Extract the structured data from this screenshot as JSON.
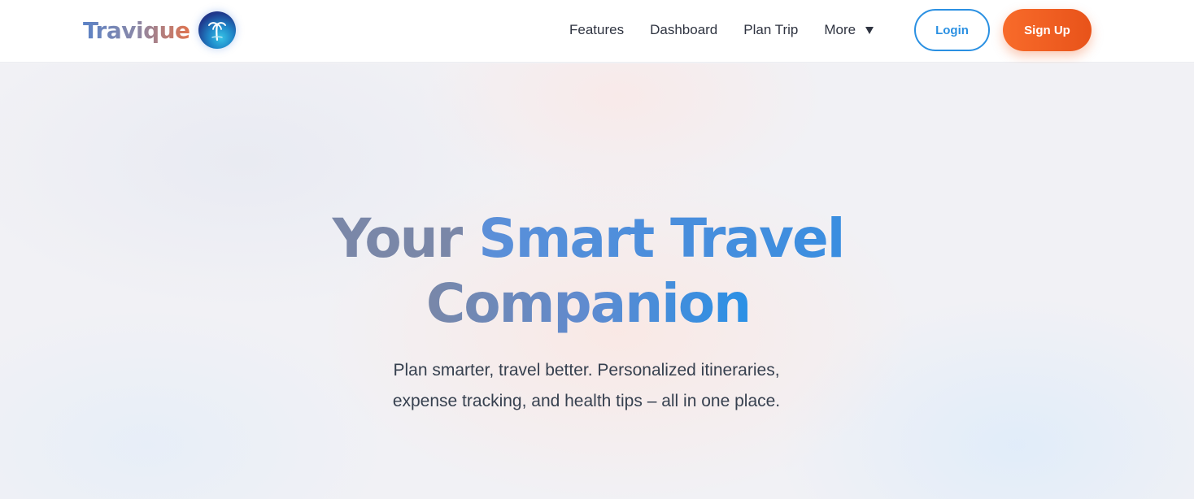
{
  "brand": {
    "name": "Travique",
    "logo_icon": "palm-tree-globe-icon"
  },
  "nav": {
    "links": [
      "Features",
      "Dashboard",
      "Plan Trip",
      "More"
    ],
    "more_caret_icon": "caret-down-icon"
  },
  "auth": {
    "login_label": "Login",
    "signup_label": "Sign Up"
  },
  "hero": {
    "title_part1": "Your",
    "title_part2": "Smart Travel",
    "title_part3": "Companion",
    "subtitle_line1": "Plan smarter, travel better. Personalized itineraries,",
    "subtitle_line2": "expense tracking, and health tips – all in one place."
  },
  "colors": {
    "accent_blue": "#2a90e2",
    "accent_orange": "#f86b2a",
    "text_dark": "#2f3441"
  }
}
